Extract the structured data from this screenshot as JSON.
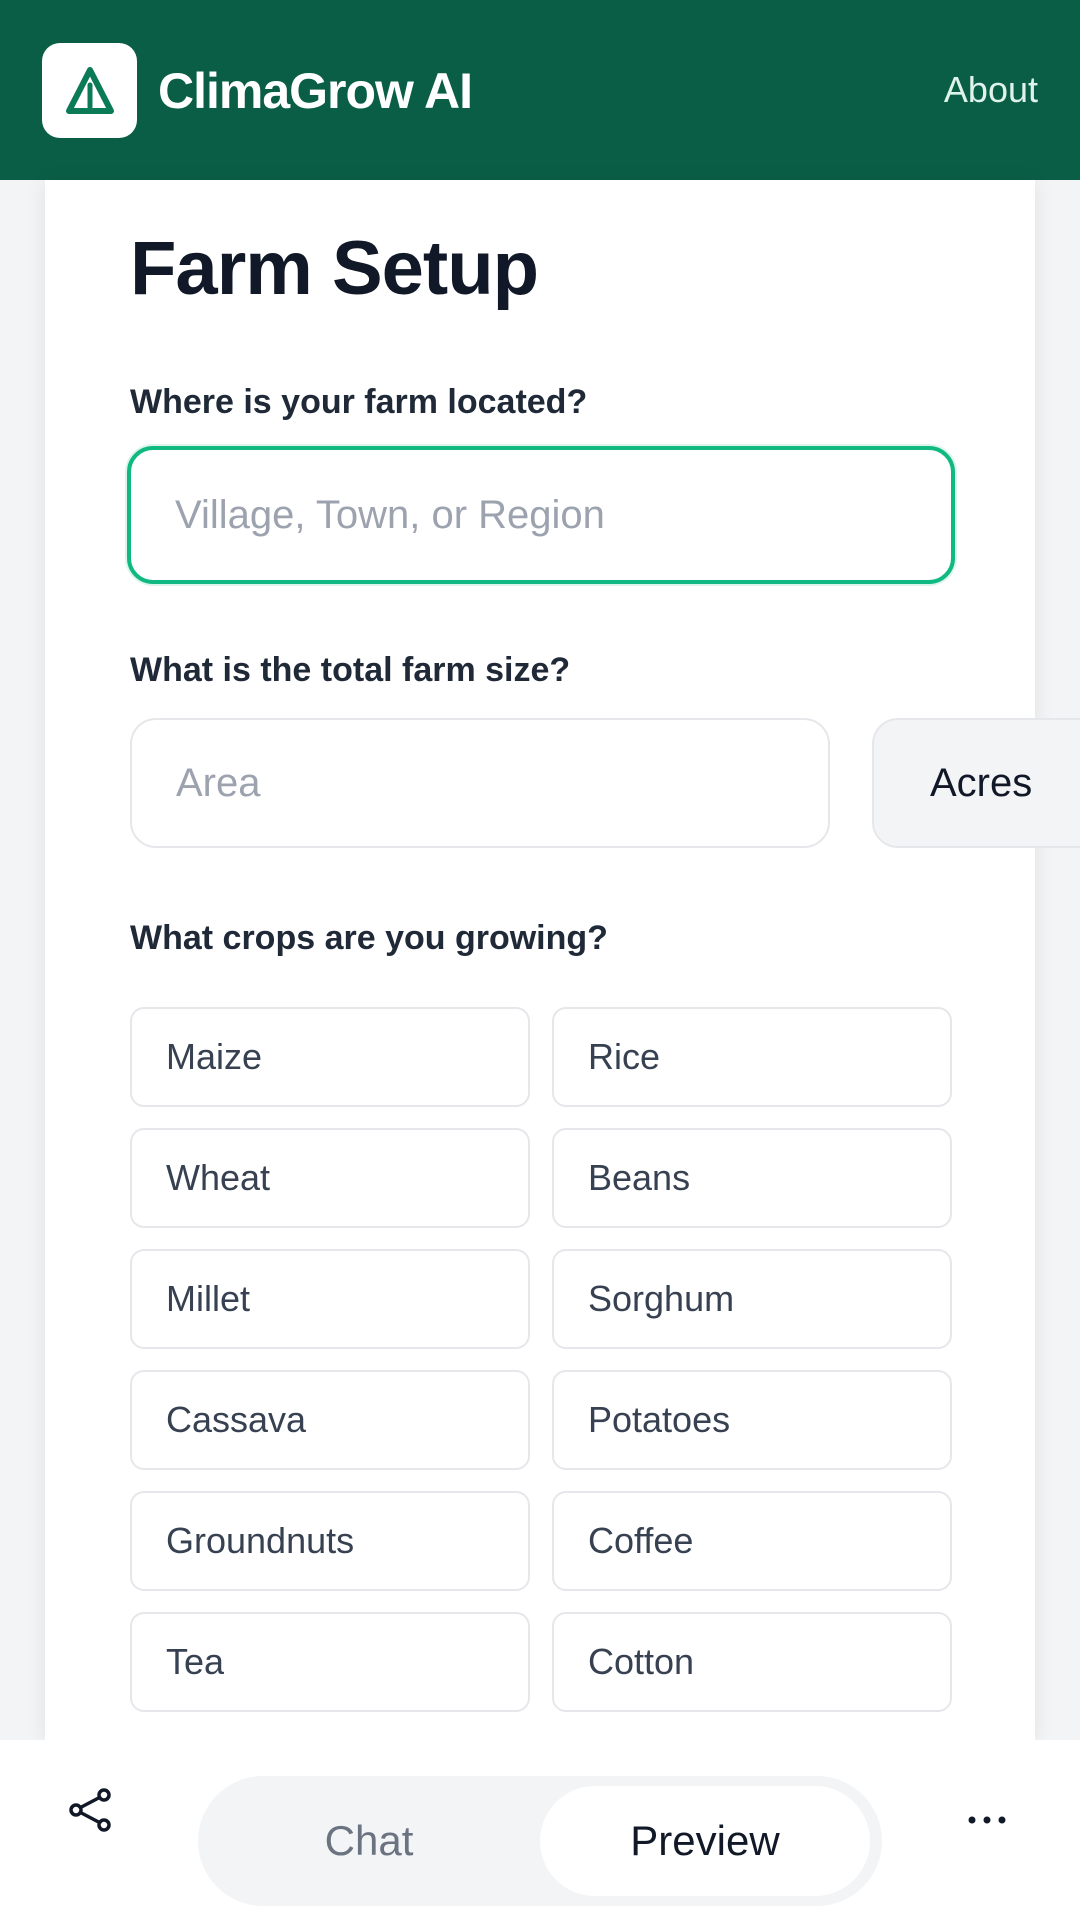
{
  "header": {
    "logo_icon": "climagrow-logo-icon",
    "app_title": "ClimaGrow AI",
    "about_label": "About",
    "background_color": "#0b5e46"
  },
  "form": {
    "title": "Farm Setup",
    "location": {
      "label": "Where is your farm located?",
      "placeholder": "Village, Town, or Region",
      "value": ""
    },
    "size": {
      "label": "What is the total farm size?",
      "placeholder": "Area",
      "value": "",
      "unit": "Acres"
    },
    "crops": {
      "label": "What crops are you growing?",
      "options": [
        "Maize",
        "Rice",
        "Wheat",
        "Beans",
        "Millet",
        "Sorghum",
        "Cassava",
        "Potatoes",
        "Groundnuts",
        "Coffee",
        "Tea",
        "Cotton"
      ]
    },
    "accent_color": "#10b981"
  },
  "bottom_bar": {
    "share_icon": "share-icon",
    "tabs": [
      "Chat",
      "Preview"
    ],
    "active_tab": "Preview",
    "more_icon": "more-horizontal-icon"
  }
}
